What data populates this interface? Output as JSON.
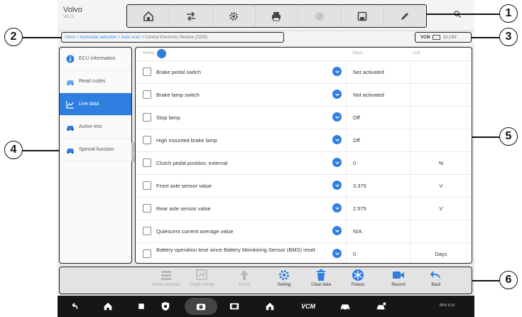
{
  "header": {
    "brand": "Volvo",
    "version": "V8.11"
  },
  "toolbar": {
    "buttons": [
      "home-icon",
      "vehicle-swap-icon",
      "settings-icon",
      "print-icon",
      "record-icon",
      "save-icon",
      "edit-icon"
    ]
  },
  "breadcrumb": {
    "path": "Volvo > Automatic selection > Auto scan > ",
    "current": "Central Electronic Module (CEM)"
  },
  "vcm": {
    "label": "VCM",
    "battery": "12.13V"
  },
  "sidebar": {
    "items": [
      {
        "label": "ECU information",
        "icon": "info-icon"
      },
      {
        "label": "Read codes",
        "icon": "car-codes-icon"
      },
      {
        "label": "Live data",
        "icon": "chart-icon",
        "active": true
      },
      {
        "label": "Active test",
        "icon": "car-test-icon"
      },
      {
        "label": "Special function",
        "icon": "car-function-icon"
      }
    ]
  },
  "table": {
    "headers": {
      "name": "Name",
      "value": "Value",
      "unit": "Unit"
    },
    "rows": [
      {
        "name": "Brake pedal switch",
        "value": "Not activated",
        "unit": ""
      },
      {
        "name": "Brake lamp switch",
        "value": "Not activated",
        "unit": ""
      },
      {
        "name": "Stop lamp",
        "value": "Off",
        "unit": ""
      },
      {
        "name": "High mounted brake lamp",
        "value": "Off",
        "unit": ""
      },
      {
        "name": "Clutch pedal position, external",
        "value": "0",
        "unit": "%"
      },
      {
        "name": "Front axle sensor value",
        "value": "3.375",
        "unit": "V"
      },
      {
        "name": "Rear axle sensor value",
        "value": "2.575",
        "unit": "V"
      },
      {
        "name": "Quiescent current average value",
        "value": "N/A",
        "unit": ""
      },
      {
        "name": "Battery operation time since Battery Monitoring Sensor (BMS) reset",
        "value": "0",
        "unit": "Days"
      }
    ]
  },
  "bottombar": {
    "buttons": [
      {
        "label": "Show selected",
        "icon": "list-icon",
        "enabled": false
      },
      {
        "label": "Graph merge",
        "icon": "graph-icon",
        "enabled": false
      },
      {
        "label": "To top",
        "icon": "arrow-up-icon",
        "enabled": false
      },
      {
        "label": "Setting",
        "icon": "gear-icon",
        "enabled": true
      },
      {
        "label": "Clear data",
        "icon": "trash-icon",
        "enabled": true
      },
      {
        "label": "Freeze",
        "icon": "snowflake-icon",
        "enabled": true
      },
      {
        "label": "Record",
        "icon": "video-icon",
        "enabled": true
      },
      {
        "label": "Back",
        "icon": "back-icon",
        "enabled": true
      }
    ]
  },
  "navbar": {
    "status": "85% 9:14"
  },
  "callouts": [
    "1",
    "2",
    "3",
    "4",
    "5",
    "6"
  ],
  "colors": {
    "accent": "#2f7fe0",
    "background": "#e9e9e9",
    "navbar": "#161616"
  }
}
